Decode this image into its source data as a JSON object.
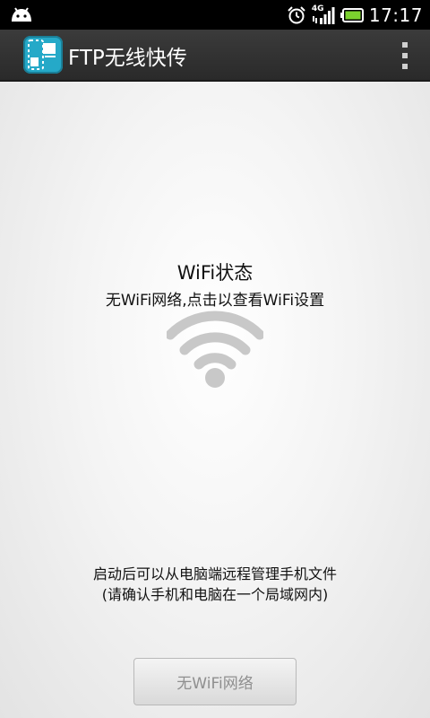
{
  "status_bar": {
    "time": "17:17",
    "network": "4G",
    "icons": [
      "android-icon",
      "alarm-icon",
      "signal-icon",
      "battery-icon"
    ]
  },
  "action_bar": {
    "title": "FTP无线快传",
    "icons": [
      "app-icon",
      "overflow-menu-icon"
    ]
  },
  "wifi_status": {
    "title": "WiFi状态",
    "subtitle": "无WiFi网络,点击以查看WiFi设置",
    "icon": "wifi-icon",
    "icon_color": "#c8c8c8"
  },
  "hint": {
    "line1": "启动后可以从电脑端远程管理手机文件",
    "line2": "(请确认手机和电脑在一个局域网内)"
  },
  "button": {
    "label": "无WiFi网络"
  },
  "colors": {
    "status_bar": "#000000",
    "action_bar": "#333333",
    "app_icon": "#25a9c8",
    "background": "#f2f2f2"
  }
}
